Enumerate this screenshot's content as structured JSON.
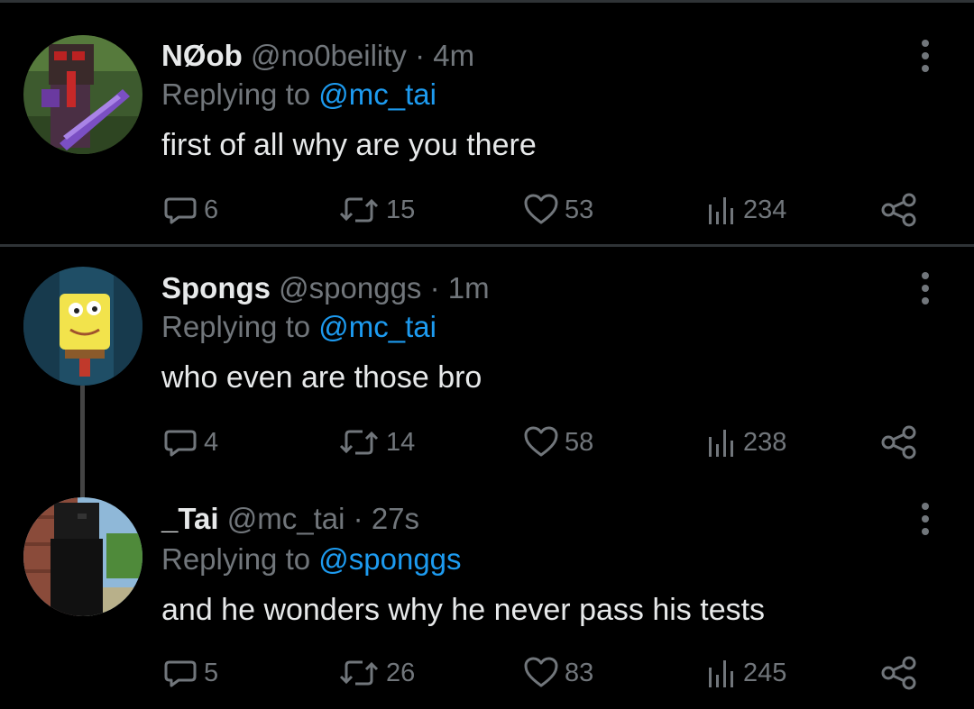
{
  "tweets": [
    {
      "display_name": "NØob",
      "handle": "@no0beility",
      "separator": "·",
      "time": "4m",
      "replying_prefix": "Replying to ",
      "replying_to": "@mc_tai",
      "text": "first of all why are you there",
      "stats": {
        "replies": "6",
        "retweets": "15",
        "likes": "53",
        "views": "234"
      }
    },
    {
      "display_name": "Spongs",
      "handle": "@sponggs",
      "separator": "·",
      "time": "1m",
      "replying_prefix": "Replying to ",
      "replying_to": "@mc_tai",
      "text": "who even are those bro",
      "stats": {
        "replies": "4",
        "retweets": "14",
        "likes": "58",
        "views": "238"
      }
    },
    {
      "display_name": "_Tai",
      "handle": "@mc_tai",
      "separator": "·",
      "time": "27s",
      "replying_prefix": "Replying to ",
      "replying_to": "@sponggs",
      "text": "and he wonders why he never pass his tests",
      "stats": {
        "replies": "5",
        "retweets": "26",
        "likes": "83",
        "views": "245"
      }
    }
  ],
  "icons": {
    "reply": "reply-icon",
    "retweet": "retweet-icon",
    "like": "heart-icon",
    "views": "views-icon",
    "share": "share-icon",
    "more": "more-options-icon"
  },
  "colors": {
    "background": "#000000",
    "primary_text": "#e7e9ea",
    "secondary_text": "#71767b",
    "link": "#1d9bf0",
    "divider": "#2f3336"
  }
}
